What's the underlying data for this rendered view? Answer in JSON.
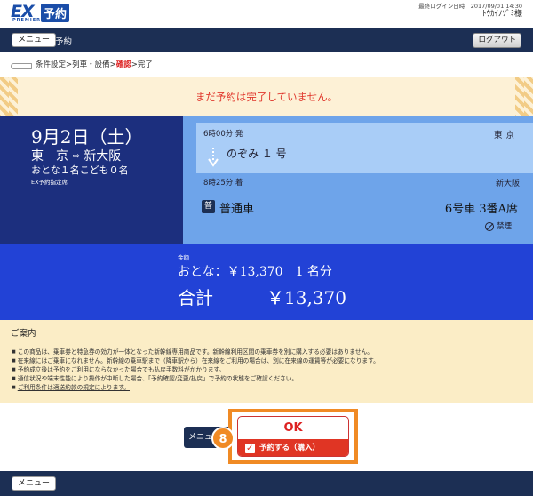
{
  "header": {
    "logo_ex": "EX",
    "logo_yoyaku": "予約",
    "logo_sub": "PREMIER",
    "last_login_label": "最終ログイン日時　2017/09/01 14:30",
    "user_name": "ﾄｳｶｲﾉｿﾞﾐ様"
  },
  "navbar": {
    "menu_label": "メニュー",
    "title": "予約",
    "logout_label": "ログアウト"
  },
  "breadcrumb": {
    "steps_before": "条件設定>列車・設備>",
    "current": "確認",
    "steps_after": ">完了"
  },
  "warning": "まだ予約は完了していません。",
  "ticket": {
    "date": "9月2日（土）",
    "route_from": "東　京",
    "route_arrow": "⇨",
    "route_to": "新大阪",
    "passengers": "おとな１名こども０名",
    "fare_type": "EX予約指定席",
    "departure_time": "6時00分 発",
    "departure_station": "東京",
    "train_name": "のぞみ １ 号",
    "arrival_time": "8時25分 着",
    "arrival_station": "新大阪",
    "car_badge": "普",
    "car_class": "普通車",
    "seat": "6号車 3番A席",
    "smoking": "禁煙"
  },
  "price": {
    "label": "金額",
    "adult_line": "おとな：￥13,370　1 名分",
    "total_label": "合計",
    "total_value": "￥13,370"
  },
  "guide": {
    "title": "ご案内",
    "items": [
      "この商品は、乗車券と特急券の効力が一体となった新幹線専用商品です。新幹線利用区間の乗車券を別に購入する必要はありません。",
      "在来線にはご乗車になれません。新幹線の乗車駅まで（降車駅から）在来線をご利用の場合は、別に在来線の運賃等が必要になります。",
      "予約成立後は予約をご利用にならなかった場合でも払戻手数料がかかります。",
      "通信状況や端末性能により操作が中断した場合、「予約確認/変更/払戻」で予約の状態をご確認ください。",
      "ご利用条件は適送約款の規定によります。"
    ]
  },
  "actions": {
    "menu_label": "メニュー",
    "ok_label": "OK",
    "confirm_label": "予約する（購入）",
    "step_number": "8"
  },
  "footer": {
    "menu_label": "メニュー"
  },
  "colors": {
    "navy": "#1c2f54",
    "ticket_dark": "#1c2f7e",
    "ticket_light": "#6ea4ea",
    "price_band": "#2242d6",
    "warning_text": "#e0372c",
    "highlight_orange": "#f08a24"
  }
}
